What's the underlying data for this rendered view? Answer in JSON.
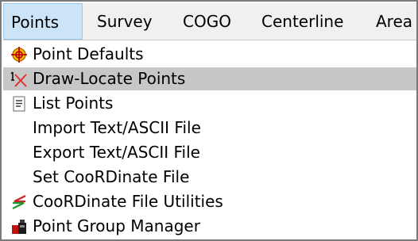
{
  "menubar": {
    "items": [
      {
        "label": "Points"
      },
      {
        "label": "Survey"
      },
      {
        "label": "COGO"
      },
      {
        "label": "Centerline"
      },
      {
        "label": "Area"
      }
    ]
  },
  "points_menu": {
    "items": [
      {
        "label": "Point Defaults",
        "icon": "point-defaults-icon"
      },
      {
        "label": "Draw-Locate Points",
        "icon": "draw-locate-points-icon",
        "highlighted": true
      },
      {
        "label": "List Points",
        "icon": "list-points-icon"
      },
      {
        "label": "Import Text/ASCII File",
        "icon": ""
      },
      {
        "label": "Export Text/ASCII File",
        "icon": ""
      },
      {
        "label": "Set CooRDinate File",
        "icon": ""
      },
      {
        "label": "CooRDinate File Utilities",
        "icon": "coordinate-file-utilities-icon"
      },
      {
        "label": "Point Group Manager",
        "icon": "point-group-manager-icon"
      }
    ]
  },
  "colors": {
    "menubar_bg": "#f0f0f0",
    "active_menu_bg": "#cce4f7",
    "highlight_bg": "#c7c7c7"
  }
}
